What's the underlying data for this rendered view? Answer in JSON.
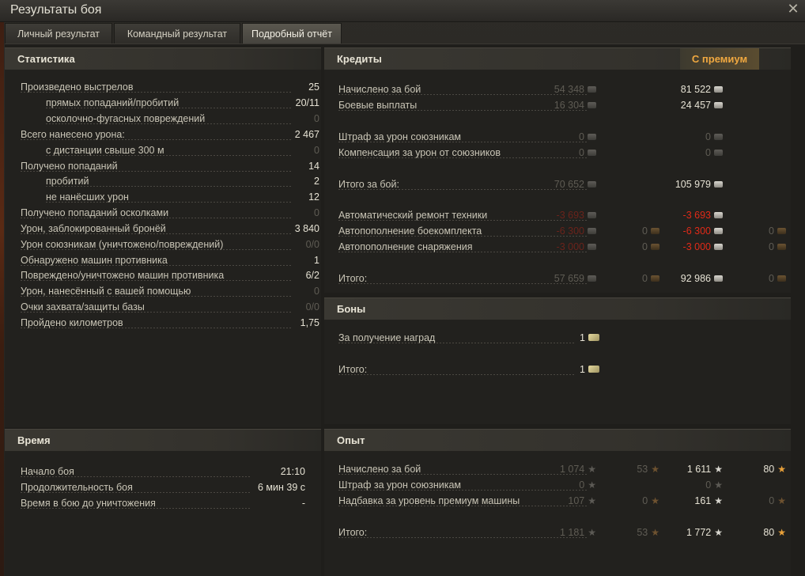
{
  "window": {
    "title": "Результаты боя"
  },
  "tabs": [
    {
      "label": "Личный результат",
      "active": false
    },
    {
      "label": "Командный результат",
      "active": false
    },
    {
      "label": "Подробный отчёт",
      "active": true
    }
  ],
  "stats": {
    "header": "Статистика",
    "rows": [
      {
        "label": "Произведено выстрелов",
        "value": "25",
        "indent": false,
        "dim": false
      },
      {
        "label": "прямых попаданий/пробитий",
        "value": "20/11",
        "indent": true,
        "dim": false
      },
      {
        "label": "осколочно-фугасных повреждений",
        "value": "0",
        "indent": true,
        "dim": true
      },
      {
        "label": "Всего нанесено урона:",
        "value": "2 467",
        "indent": false,
        "dim": false
      },
      {
        "label": "с дистанции свыше 300 м",
        "value": "0",
        "indent": true,
        "dim": true
      },
      {
        "label": "Получено попаданий",
        "value": "14",
        "indent": false,
        "dim": false
      },
      {
        "label": "пробитий",
        "value": "2",
        "indent": true,
        "dim": false
      },
      {
        "label": "не нанёсших урон",
        "value": "12",
        "indent": true,
        "dim": false
      },
      {
        "label": "Получено попаданий осколками",
        "value": "0",
        "indent": false,
        "dim": true
      },
      {
        "label": "Урон, заблокированный бронёй",
        "value": "3 840",
        "indent": false,
        "dim": false
      },
      {
        "label": "Урон союзникам (уничтожено/повреждений)",
        "value": "0/0",
        "indent": false,
        "dim": true
      },
      {
        "label": "Обнаружено машин противника",
        "value": "1",
        "indent": false,
        "dim": false
      },
      {
        "label": "Повреждено/уничтожено машин противника",
        "value": "6/2",
        "indent": false,
        "dim": false
      },
      {
        "label": "Урон, нанесённый с вашей помощью",
        "value": "0",
        "indent": false,
        "dim": true
      },
      {
        "label": "Очки захвата/защиты базы",
        "value": "0/0",
        "indent": false,
        "dim": true
      },
      {
        "label": "Пройдено километров",
        "value": "1,75",
        "indent": false,
        "dim": false
      }
    ]
  },
  "time": {
    "header": "Время",
    "rows": [
      {
        "label": "Начало боя",
        "value": "21:10"
      },
      {
        "label": "Продолжительность боя",
        "value": "6 мин 39 с"
      },
      {
        "label": "Время в бою до уничтожения",
        "value": "-"
      }
    ]
  },
  "credits": {
    "header": "Кредиты",
    "premium_label": "С премиум",
    "rows": [
      {
        "label": "Начислено за бой",
        "base": "54 348",
        "base_style": "dim",
        "base_gold": "",
        "prem": "81 522",
        "prem_style": "normal",
        "prem_gold": ""
      },
      {
        "label": "Боевые выплаты",
        "base": "16 304",
        "base_style": "dim",
        "base_gold": "",
        "prem": "24 457",
        "prem_style": "normal",
        "prem_gold": ""
      },
      {
        "label": "Штраф за урон союзникам",
        "base": "0",
        "base_style": "dim",
        "base_gold": "",
        "prem": "0",
        "prem_style": "dim",
        "prem_gold": ""
      },
      {
        "label": "Компенсация за урон от союзников",
        "base": "0",
        "base_style": "dim",
        "base_gold": "",
        "prem": "0",
        "prem_style": "dim",
        "prem_gold": ""
      },
      {
        "label": "Итого за бой:",
        "base": "70 652",
        "base_style": "dim",
        "base_gold": "",
        "prem": "105 979",
        "prem_style": "normal",
        "prem_gold": ""
      },
      {
        "label": "Автоматический ремонт техники",
        "base": "-3 693",
        "base_style": "dimred",
        "base_gold": "",
        "prem": "-3 693",
        "prem_style": "red",
        "prem_gold": ""
      },
      {
        "label": "Автопополнение боекомплекта",
        "base": "-6 300",
        "base_style": "dimred",
        "base_gold": "0",
        "prem": "-6 300",
        "prem_style": "red",
        "prem_gold": "0"
      },
      {
        "label": "Автопополнение снаряжения",
        "base": "-3 000",
        "base_style": "dimred",
        "base_gold": "0",
        "prem": "-3 000",
        "prem_style": "red",
        "prem_gold": "0"
      },
      {
        "label": "Итого:",
        "base": "57 659",
        "base_style": "dim",
        "base_gold": "0",
        "prem": "92 986",
        "prem_style": "normal",
        "prem_gold": "0"
      }
    ]
  },
  "bonds": {
    "header": "Боны",
    "rows": [
      {
        "label": "За получение наград",
        "value": "1"
      },
      {
        "label": "Итого:",
        "value": "1"
      }
    ]
  },
  "xp": {
    "header": "Опыт",
    "rows": [
      {
        "label": "Начислено за бой",
        "base": "1 074",
        "base_free": "53",
        "prem": "1 611",
        "prem_free": "80",
        "prem_dim": false,
        "prem_free_dim": false
      },
      {
        "label": "Штраф за урон союзникам",
        "base": "0",
        "base_free": "",
        "prem": "0",
        "prem_free": "",
        "prem_dim": true,
        "prem_free_dim": true
      },
      {
        "label": "Надбавка за уровень премиум машины",
        "base": "107",
        "base_free": "0",
        "prem": "161",
        "prem_free": "0",
        "prem_dim": false,
        "prem_free_dim": true
      },
      {
        "label": "Итого:",
        "base": "1 181",
        "base_free": "53",
        "prem": "1 772",
        "prem_free": "80",
        "prem_dim": false,
        "prem_free_dim": false
      }
    ]
  }
}
